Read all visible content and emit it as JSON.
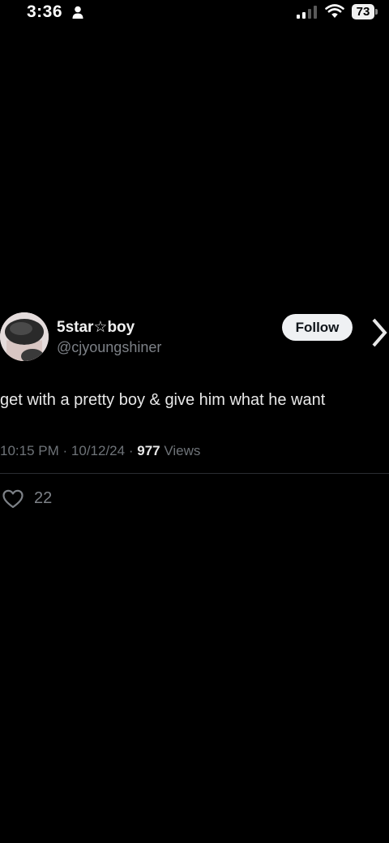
{
  "status_bar": {
    "time": "3:36",
    "battery": "73",
    "icons": [
      "person-icon",
      "signal-icon",
      "wifi-icon",
      "battery-icon"
    ]
  },
  "tweet": {
    "display_name": "5star☆boy",
    "handle": "@cjyoungshiner",
    "follow_label": "Follow",
    "text": "get with a pretty boy & give him what he want",
    "time": "10:15 PM",
    "date": "10/12/24",
    "separator": "·",
    "views_count": "977",
    "views_label": "Views",
    "like_count": "22"
  },
  "colors": {
    "background": "#000000",
    "primary_text": "#e8e8e8",
    "secondary_text": "#7d8187",
    "follow_bg": "#eff1f3"
  }
}
